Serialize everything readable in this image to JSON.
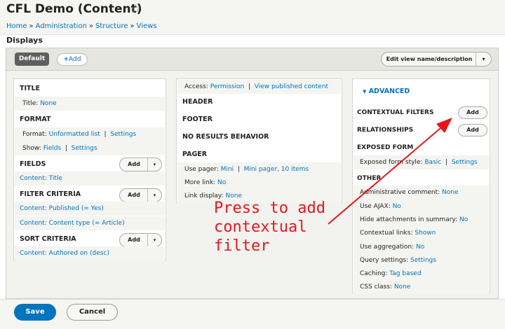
{
  "header": {
    "title": "CFL Demo (Content)",
    "star_icon": "☆",
    "breadcrumb": [
      {
        "label": "Home"
      },
      {
        "label": "Administration"
      },
      {
        "label": "Structure"
      },
      {
        "label": "Views"
      }
    ],
    "separator": "»"
  },
  "displays_heading": "Displays",
  "display_tabs": {
    "default_label": "Default",
    "add_label": "Add",
    "add_icon": "+",
    "edit_label": "Edit view name/description",
    "dropdown_icon": "▾"
  },
  "left_column": {
    "title_section": {
      "heading": "TITLE",
      "title_label": "Title:",
      "title_value": "None"
    },
    "format_section": {
      "heading": "FORMAT",
      "format_label": "Format:",
      "format_value": "Unformatted list",
      "format_settings": "Settings",
      "show_label": "Show:",
      "show_value": "Fields",
      "show_settings": "Settings"
    },
    "fields_section": {
      "heading": "FIELDS",
      "add_label": "Add",
      "items": [
        "Content: Title"
      ]
    },
    "filter_section": {
      "heading": "FILTER CRITERIA",
      "add_label": "Add",
      "items": [
        "Content: Published (= Yes)",
        "Content: Content type (= Article)"
      ]
    },
    "sort_section": {
      "heading": "SORT CRITERIA",
      "add_label": "Add",
      "items": [
        "Content: Authored on (desc)"
      ]
    }
  },
  "middle_column": {
    "access_label": "Access:",
    "access_value": "Permission",
    "access_link": "View published content",
    "header_heading": "HEADER",
    "footer_heading": "FOOTER",
    "no_results_heading": "NO RESULTS BEHAVIOR",
    "pager_heading": "PAGER",
    "use_pager_label": "Use pager:",
    "use_pager_value": "Mini",
    "use_pager_settings": "Mini pager, 10 items",
    "more_link_label": "More link:",
    "more_link_value": "No",
    "link_display_label": "Link display:",
    "link_display_value": "None"
  },
  "advanced_column": {
    "toggle_icon": "▼",
    "heading": "ADVANCED",
    "contextual_filters_heading": "CONTEXTUAL FILTERS",
    "relationships_heading": "RELATIONSHIPS",
    "add_label": "Add",
    "exposed_form_heading": "EXPOSED FORM",
    "exposed_style_label": "Exposed form style:",
    "exposed_style_value": "Basic",
    "exposed_style_settings": "Settings",
    "other_heading": "OTHER",
    "other_rows": [
      {
        "label": "Administrative comment:",
        "value": "None"
      },
      {
        "label": "Use AJAX:",
        "value": "No"
      },
      {
        "label": "Hide attachments in summary:",
        "value": "No"
      },
      {
        "label": "Contextual links:",
        "value": "Shown"
      },
      {
        "label": "Use aggregation:",
        "value": "No"
      },
      {
        "label": "Query settings:",
        "value": "Settings"
      },
      {
        "label": "Caching:",
        "value": "Tag based"
      },
      {
        "label": "CSS class:",
        "value": "None"
      }
    ]
  },
  "annotation": {
    "text": "Press to add\ncontextual\nfilter",
    "color": "#e8161b"
  },
  "actions": {
    "save_label": "Save",
    "cancel_label": "Cancel"
  },
  "colors": {
    "link": "#0074bd",
    "primary_button": "#0074bd"
  }
}
